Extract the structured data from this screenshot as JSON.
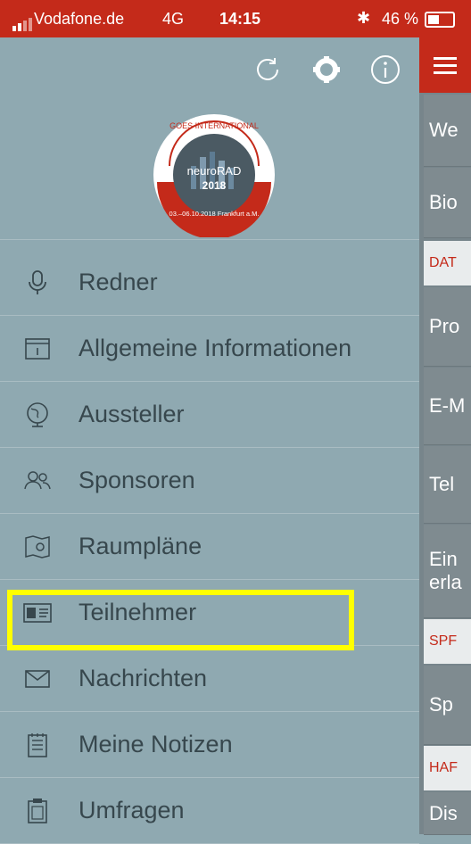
{
  "status_bar": {
    "carrier": "Vodafone.de",
    "network": "4G",
    "time": "14:15",
    "battery": "46 %"
  },
  "drawer": {
    "top_icons": [
      "refresh-icon",
      "gear-icon",
      "info-icon"
    ],
    "logo": {
      "ring_text": "GOES INTERNATIONAL",
      "brand": "neuroRAD",
      "year": "2018",
      "dates": "03.–06.10.2018 Frankfurt a.M."
    },
    "menu": [
      {
        "label": "Redner",
        "icon": "microphone-icon"
      },
      {
        "label": "Allgemeine Informationen",
        "icon": "info-box-icon"
      },
      {
        "label": "Aussteller",
        "icon": "globe-icon"
      },
      {
        "label": "Sponsoren",
        "icon": "people-icon"
      },
      {
        "label": "Raumpläne",
        "icon": "map-pin-icon"
      },
      {
        "label": "Teilnehmer",
        "icon": "id-card-icon"
      },
      {
        "label": "Nachrichten",
        "icon": "envelope-icon"
      },
      {
        "label": "Meine Notizen",
        "icon": "notepad-icon"
      },
      {
        "label": "Umfragen",
        "icon": "clipboard-icon"
      }
    ],
    "highlighted": "Teilnehmer"
  },
  "panel": {
    "rows": [
      {
        "text": "We",
        "kind": "row"
      },
      {
        "text": "Bio",
        "kind": "row"
      },
      {
        "text": "DAT",
        "kind": "section"
      },
      {
        "text": "Pro",
        "kind": "row"
      },
      {
        "text": "E-M",
        "kind": "row"
      },
      {
        "text": "Tel",
        "kind": "row"
      },
      {
        "text": "Ein erla",
        "kind": "row"
      },
      {
        "text": "SPF",
        "kind": "section"
      },
      {
        "text": "Sp",
        "kind": "row"
      },
      {
        "text": "HAF",
        "kind": "section"
      },
      {
        "text": "Dis",
        "kind": "row"
      }
    ]
  },
  "colors": {
    "brand_red": "#c42a1a",
    "drawer_bg": "#8fa9b1",
    "highlight": "#ffff00"
  }
}
